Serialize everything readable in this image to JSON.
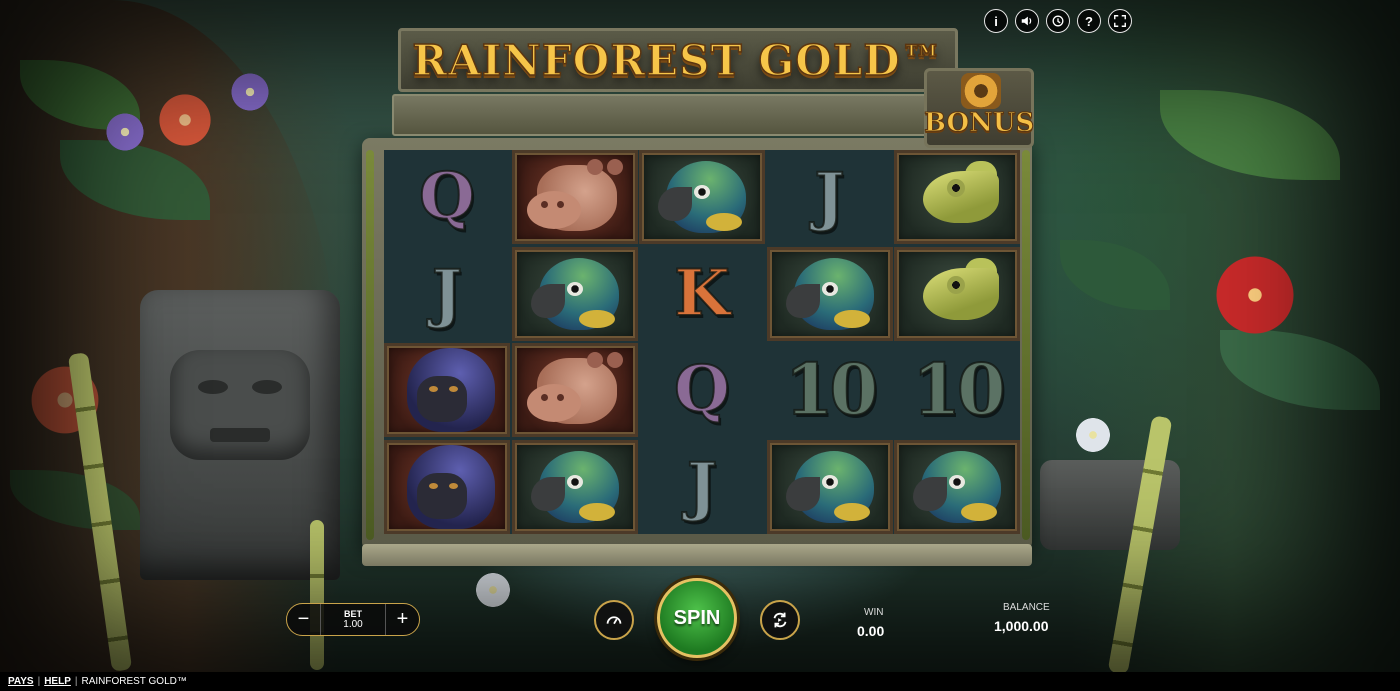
{
  "game": {
    "title": "RAINFOREST GOLD™",
    "bonus_label": "BONUS"
  },
  "top_icons": [
    {
      "name": "info-icon",
      "glyph": "i"
    },
    {
      "name": "sound-icon",
      "glyph": ""
    },
    {
      "name": "history-icon",
      "glyph": ""
    },
    {
      "name": "help-icon",
      "glyph": "?"
    },
    {
      "name": "fullscreen-icon",
      "glyph": ""
    }
  ],
  "reels": [
    [
      "Q",
      "J",
      "gorilla",
      "gorilla"
    ],
    [
      "hippo",
      "parrot",
      "hippo",
      "parrot"
    ],
    [
      "parrot",
      "K",
      "Q",
      "J"
    ],
    [
      "J",
      "parrot",
      "10",
      "parrot"
    ],
    [
      "chameleon",
      "chameleon",
      "10",
      "parrot"
    ]
  ],
  "controls": {
    "bet_label": "BET",
    "bet_value": "1.00",
    "minus": "−",
    "plus": "+",
    "spin_label": "SPIN",
    "win_label": "WIN",
    "win_value": "0.00",
    "balance_label": "BALANCE",
    "balance_value": "1,000.00"
  },
  "footer": {
    "pays": "PAYS",
    "help": "HELP",
    "sep": "|",
    "game_name": "RAINFOREST GOLD™"
  },
  "colors": {
    "gold_accent": "#c9a34a",
    "spin_green": "#2f9a2f",
    "title_gold": "#f6c549"
  }
}
